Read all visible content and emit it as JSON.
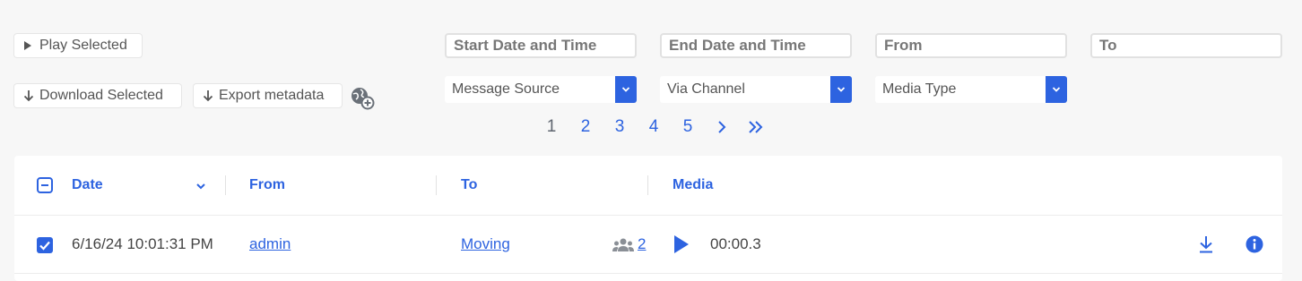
{
  "toolbar": {
    "play_selected": "Play Selected",
    "download_selected": "Download Selected",
    "export_metadata": "Export metadata"
  },
  "filters": {
    "start_placeholder": "Start Date and Time",
    "end_placeholder": "End Date and Time",
    "from_placeholder": "From",
    "to_placeholder": "To",
    "message_source": "Message Source",
    "via_channel": "Via Channel",
    "media_type": "Media Type"
  },
  "pagination": {
    "pages": [
      "1",
      "2",
      "3",
      "4",
      "5"
    ],
    "current": "1"
  },
  "table": {
    "columns": [
      "Date",
      "From",
      "To",
      "Media"
    ],
    "rows": [
      {
        "checked": true,
        "date": "6/16/24 10:01:31 PM",
        "from": "admin",
        "to": "Moving",
        "group_count": "2",
        "duration": "00:00.3"
      }
    ]
  },
  "colors": {
    "accent": "#2d63e0",
    "background": "#f7f7f7"
  },
  "icons": [
    "play-icon",
    "download-arrow-icon",
    "globe-add-icon",
    "chevron-down-icon",
    "chevron-right-icon",
    "double-chevron-right-icon",
    "checkbox-indeterminate-icon",
    "checkbox-checked-icon",
    "group-icon",
    "info-icon"
  ]
}
